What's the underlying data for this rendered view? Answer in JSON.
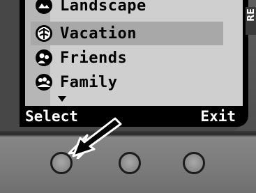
{
  "screen": {
    "menu_items": [
      {
        "label": "Landscape",
        "icon": "landscape-icon"
      },
      {
        "label": "Vacation",
        "icon": "vacation-icon"
      },
      {
        "label": "Friends",
        "icon": "friends-icon"
      },
      {
        "label": "Family",
        "icon": "family-icon"
      }
    ],
    "selected_item": "Vacation",
    "more_below_icon": "scroll-down-arrow-icon"
  },
  "softkeys": {
    "left_label": "Select",
    "right_label": "Exit"
  },
  "side_label": "RE",
  "hardware_buttons": [
    "left-soft-button",
    "center-button",
    "right-soft-button"
  ],
  "annotation": {
    "icon": "pointer-arrow-icon",
    "points_to": "left-soft-button"
  },
  "colors": {
    "lcd_background": "#cfcfcf",
    "selection_highlight": "#a8a8a8",
    "softkey_bar": "#000000",
    "softkey_text": "#ffffff"
  }
}
